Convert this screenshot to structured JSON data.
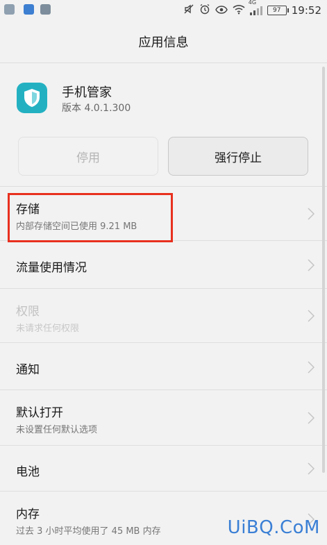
{
  "status_bar": {
    "battery": "97",
    "time": "19:52",
    "network_label": "4G"
  },
  "title_bar": {
    "title": "应用信息"
  },
  "app": {
    "name": "手机管家",
    "version": "版本 4.0.1.300",
    "icon_color": "#23b1c2"
  },
  "buttons": {
    "disable_label": "停用",
    "force_stop_label": "强行停止"
  },
  "list": {
    "storage": {
      "title": "存储",
      "subtitle": "内部存储空间已使用 9.21 MB"
    },
    "data_usage": {
      "title": "流量使用情况"
    },
    "permissions": {
      "title": "权限",
      "subtitle": "未请求任何权限"
    },
    "notifications": {
      "title": "通知"
    },
    "open_by_default": {
      "title": "默认打开",
      "subtitle": "未设置任何默认选项"
    },
    "battery": {
      "title": "电池"
    },
    "memory": {
      "title": "内存",
      "subtitle": "过去 3 小时平均使用了 45 MB 内存"
    }
  },
  "watermark": "UiBQ.CoM",
  "colors": {
    "highlight": "#e8301e",
    "watermark": "#3a7fd5"
  }
}
